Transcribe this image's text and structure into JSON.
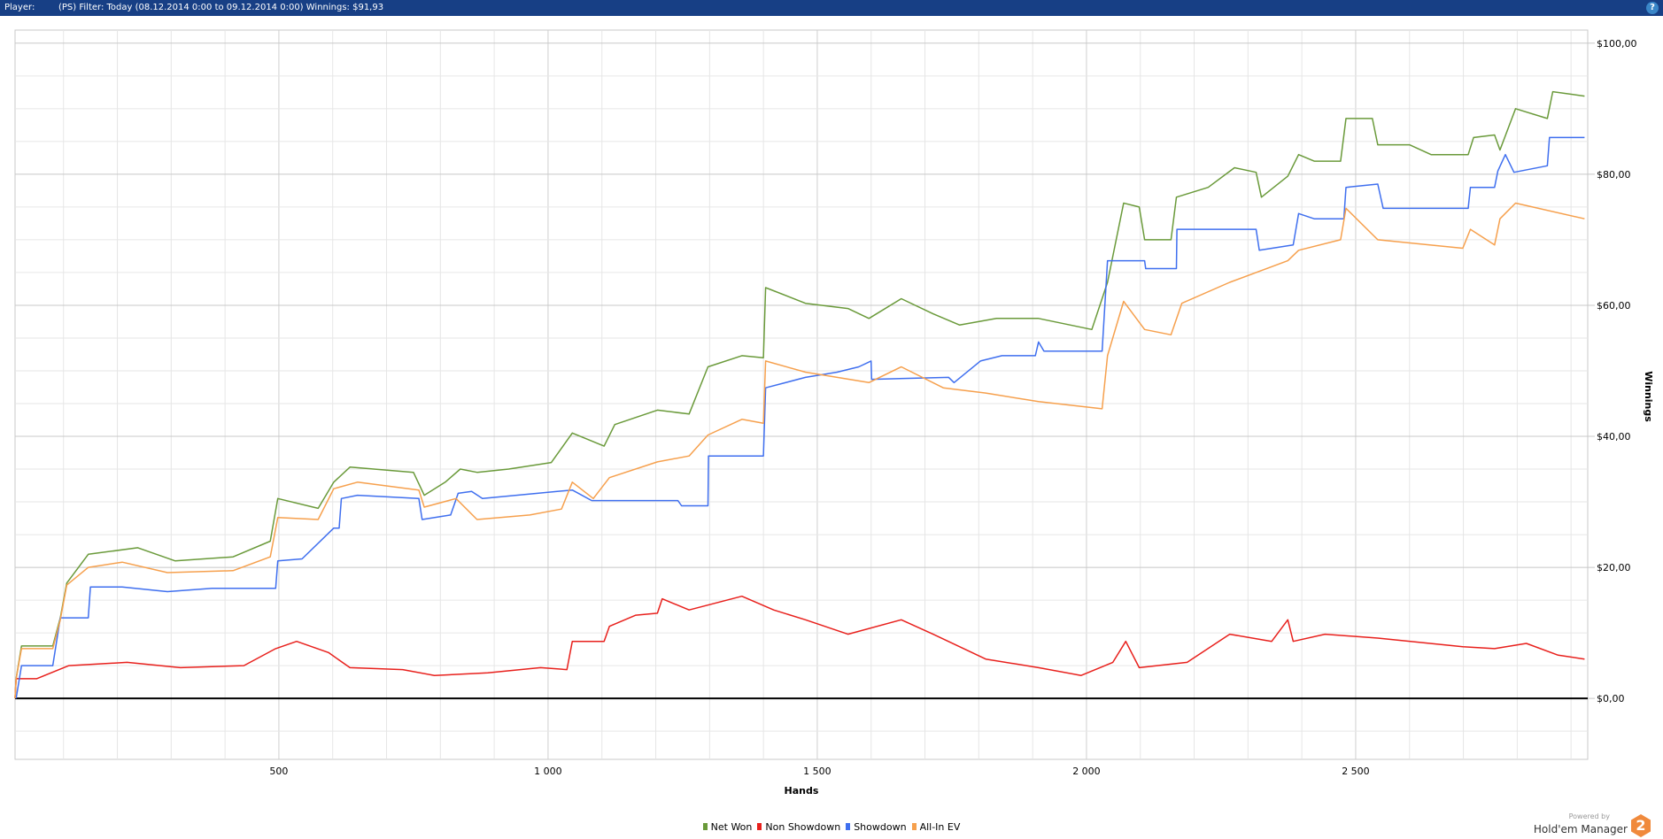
{
  "header": {
    "player_label": "Player:",
    "filter_text": "(PS) Filter: Today (08.12.2014 0:00 to 09.12.2014 0:00) Winnings: $91,93",
    "help_icon": "?"
  },
  "branding": {
    "powered_by": "Powered by",
    "product": "Hold'em Manager",
    "logo_text": "2"
  },
  "chart_data": {
    "type": "line",
    "xlabel": "Hands",
    "ylabel": "Winnings",
    "xlim": [
      10,
      2931
    ],
    "ylim": [
      -9.3,
      102
    ],
    "x_ticks": [
      {
        "v": 500,
        "label": "500"
      },
      {
        "v": 1000,
        "label": "1 000"
      },
      {
        "v": 1500,
        "label": "1 500"
      },
      {
        "v": 2000,
        "label": "2 000"
      },
      {
        "v": 2500,
        "label": "2 500"
      }
    ],
    "y_ticks": [
      {
        "v": 0,
        "label": "$0,00"
      },
      {
        "v": 20,
        "label": "$20,00"
      },
      {
        "v": 40,
        "label": "$40,00"
      },
      {
        "v": 60,
        "label": "$60,00"
      },
      {
        "v": 80,
        "label": "$80,00"
      },
      {
        "v": 100,
        "label": "$100,00"
      }
    ],
    "grid": true,
    "legend_position": "bottom",
    "series": [
      {
        "name": "Net Won",
        "color": "#6a9a3a",
        "points": [
          [
            10,
            0
          ],
          [
            12,
            3
          ],
          [
            22,
            8
          ],
          [
            80,
            8
          ],
          [
            94,
            12.3
          ],
          [
            106,
            17.6
          ],
          [
            146,
            22
          ],
          [
            238,
            23
          ],
          [
            307,
            21
          ],
          [
            415,
            21.6
          ],
          [
            484,
            24
          ],
          [
            498,
            30.5
          ],
          [
            573,
            29
          ],
          [
            602,
            33
          ],
          [
            632,
            35.3
          ],
          [
            750,
            34.5
          ],
          [
            770,
            31
          ],
          [
            809,
            33
          ],
          [
            837,
            35
          ],
          [
            868,
            34.5
          ],
          [
            927,
            35
          ],
          [
            1006,
            36
          ],
          [
            1045,
            40.5
          ],
          [
            1104,
            38.5
          ],
          [
            1124,
            41.8
          ],
          [
            1203,
            44
          ],
          [
            1262,
            43.4
          ],
          [
            1297,
            50.6
          ],
          [
            1360,
            52.3
          ],
          [
            1400,
            52
          ],
          [
            1404,
            62.7
          ],
          [
            1478,
            60.3
          ],
          [
            1557,
            59.5
          ],
          [
            1596,
            58
          ],
          [
            1656,
            61
          ],
          [
            1715,
            58.7
          ],
          [
            1764,
            57
          ],
          [
            1833,
            58
          ],
          [
            1911,
            58
          ],
          [
            2010,
            56.3
          ],
          [
            2039,
            63.5
          ],
          [
            2069,
            75.6
          ],
          [
            2098,
            75
          ],
          [
            2108,
            70
          ],
          [
            2157,
            70
          ],
          [
            2167,
            76.5
          ],
          [
            2226,
            78
          ],
          [
            2275,
            81
          ],
          [
            2315,
            80.3
          ],
          [
            2325,
            76.5
          ],
          [
            2374,
            79.7
          ],
          [
            2394,
            83
          ],
          [
            2423,
            82
          ],
          [
            2472,
            82
          ],
          [
            2482,
            88.5
          ],
          [
            2531,
            88.5
          ],
          [
            2541,
            84.5
          ],
          [
            2600,
            84.5
          ],
          [
            2640,
            83
          ],
          [
            2709,
            83
          ],
          [
            2719,
            85.6
          ],
          [
            2758,
            86
          ],
          [
            2768,
            83.7
          ],
          [
            2797,
            90
          ],
          [
            2856,
            88.5
          ],
          [
            2866,
            92.6
          ],
          [
            2925,
            91.93
          ]
        ]
      },
      {
        "name": "Non Showdown",
        "color": "#e8201c",
        "points": [
          [
            10,
            0
          ],
          [
            12,
            3
          ],
          [
            50,
            3
          ],
          [
            110,
            5
          ],
          [
            218,
            5.5
          ],
          [
            317,
            4.7
          ],
          [
            435,
            5
          ],
          [
            494,
            7.6
          ],
          [
            533,
            8.7
          ],
          [
            592,
            7
          ],
          [
            632,
            4.7
          ],
          [
            730,
            4.4
          ],
          [
            789,
            3.5
          ],
          [
            888,
            3.9
          ],
          [
            986,
            4.7
          ],
          [
            1035,
            4.4
          ],
          [
            1045,
            8.7
          ],
          [
            1104,
            8.7
          ],
          [
            1114,
            11
          ],
          [
            1163,
            12.7
          ],
          [
            1203,
            13
          ],
          [
            1212,
            15.2
          ],
          [
            1262,
            13.5
          ],
          [
            1360,
            15.6
          ],
          [
            1419,
            13.5
          ],
          [
            1478,
            12
          ],
          [
            1557,
            9.8
          ],
          [
            1656,
            12
          ],
          [
            1715,
            9.8
          ],
          [
            1813,
            6
          ],
          [
            1911,
            4.7
          ],
          [
            1990,
            3.5
          ],
          [
            2049,
            5.5
          ],
          [
            2073,
            8.7
          ],
          [
            2098,
            4.7
          ],
          [
            2187,
            5.5
          ],
          [
            2266,
            9.8
          ],
          [
            2344,
            8.7
          ],
          [
            2374,
            12
          ],
          [
            2384,
            8.7
          ],
          [
            2443,
            9.8
          ],
          [
            2541,
            9.2
          ],
          [
            2699,
            7.9
          ],
          [
            2758,
            7.6
          ],
          [
            2817,
            8.4
          ],
          [
            2876,
            6.6
          ],
          [
            2925,
            6
          ]
        ]
      },
      {
        "name": "Showdown",
        "color": "#3f6fef",
        "points": [
          [
            12,
            0
          ],
          [
            22,
            5
          ],
          [
            80,
            5
          ],
          [
            94,
            12.3
          ],
          [
            146,
            12.3
          ],
          [
            150,
            17
          ],
          [
            209,
            17
          ],
          [
            293,
            16.3
          ],
          [
            376,
            16.8
          ],
          [
            494,
            16.8
          ],
          [
            498,
            21
          ],
          [
            543,
            21.3
          ],
          [
            602,
            26
          ],
          [
            612,
            26
          ],
          [
            616,
            30.5
          ],
          [
            646,
            31
          ],
          [
            760,
            30.5
          ],
          [
            766,
            27.3
          ],
          [
            819,
            28
          ],
          [
            833,
            31.3
          ],
          [
            858,
            31.6
          ],
          [
            878,
            30.5
          ],
          [
            1045,
            31.8
          ],
          [
            1081,
            30.2
          ],
          [
            1241,
            30.2
          ],
          [
            1248,
            29.4
          ],
          [
            1297,
            29.4
          ],
          [
            1298,
            37
          ],
          [
            1400,
            37
          ],
          [
            1404,
            47.4
          ],
          [
            1478,
            49
          ],
          [
            1537,
            49.8
          ],
          [
            1577,
            50.6
          ],
          [
            1600,
            51.5
          ],
          [
            1601,
            48.7
          ],
          [
            1744,
            49
          ],
          [
            1754,
            48.2
          ],
          [
            1803,
            51.5
          ],
          [
            1843,
            52.3
          ],
          [
            1905,
            52.3
          ],
          [
            1911,
            54.4
          ],
          [
            1921,
            53
          ],
          [
            2029,
            53
          ],
          [
            2039,
            66.8
          ],
          [
            2108,
            66.8
          ],
          [
            2110,
            65.6
          ],
          [
            2167,
            65.6
          ],
          [
            2168,
            71.6
          ],
          [
            2315,
            71.6
          ],
          [
            2321,
            68.4
          ],
          [
            2384,
            69.2
          ],
          [
            2394,
            74
          ],
          [
            2423,
            73.2
          ],
          [
            2478,
            73.2
          ],
          [
            2482,
            78
          ],
          [
            2541,
            78.5
          ],
          [
            2551,
            74.8
          ],
          [
            2709,
            74.8
          ],
          [
            2713,
            78
          ],
          [
            2758,
            78
          ],
          [
            2764,
            80.5
          ],
          [
            2778,
            83
          ],
          [
            2794,
            80.3
          ],
          [
            2856,
            81.3
          ],
          [
            2860,
            85.6
          ],
          [
            2925,
            85.6
          ]
        ]
      },
      {
        "name": "All-In EV",
        "color": "#f6a04d",
        "points": [
          [
            10,
            0
          ],
          [
            12,
            3
          ],
          [
            22,
            7.6
          ],
          [
            80,
            7.6
          ],
          [
            94,
            12
          ],
          [
            106,
            17.3
          ],
          [
            146,
            20
          ],
          [
            209,
            20.8
          ],
          [
            293,
            19.2
          ],
          [
            415,
            19.5
          ],
          [
            484,
            21.6
          ],
          [
            498,
            27.6
          ],
          [
            573,
            27.3
          ],
          [
            602,
            32
          ],
          [
            646,
            33
          ],
          [
            760,
            31.8
          ],
          [
            770,
            29.2
          ],
          [
            829,
            30.5
          ],
          [
            868,
            27.3
          ],
          [
            966,
            28
          ],
          [
            1025,
            28.9
          ],
          [
            1045,
            33
          ],
          [
            1084,
            30.5
          ],
          [
            1114,
            33.7
          ],
          [
            1203,
            36.1
          ],
          [
            1262,
            37
          ],
          [
            1297,
            40.2
          ],
          [
            1360,
            42.6
          ],
          [
            1400,
            42
          ],
          [
            1404,
            51.5
          ],
          [
            1478,
            49.8
          ],
          [
            1596,
            48.2
          ],
          [
            1656,
            50.6
          ],
          [
            1734,
            47.4
          ],
          [
            1813,
            46.6
          ],
          [
            1911,
            45.3
          ],
          [
            2029,
            44.2
          ],
          [
            2039,
            52.3
          ],
          [
            2069,
            60.6
          ],
          [
            2108,
            56.3
          ],
          [
            2157,
            55.5
          ],
          [
            2177,
            60.3
          ],
          [
            2266,
            63.5
          ],
          [
            2374,
            66.8
          ],
          [
            2394,
            68.4
          ],
          [
            2472,
            70
          ],
          [
            2482,
            74.8
          ],
          [
            2541,
            70
          ],
          [
            2699,
            68.7
          ],
          [
            2713,
            71.6
          ],
          [
            2758,
            69.2
          ],
          [
            2768,
            73.2
          ],
          [
            2797,
            75.6
          ],
          [
            2925,
            73.2
          ]
        ]
      }
    ]
  }
}
